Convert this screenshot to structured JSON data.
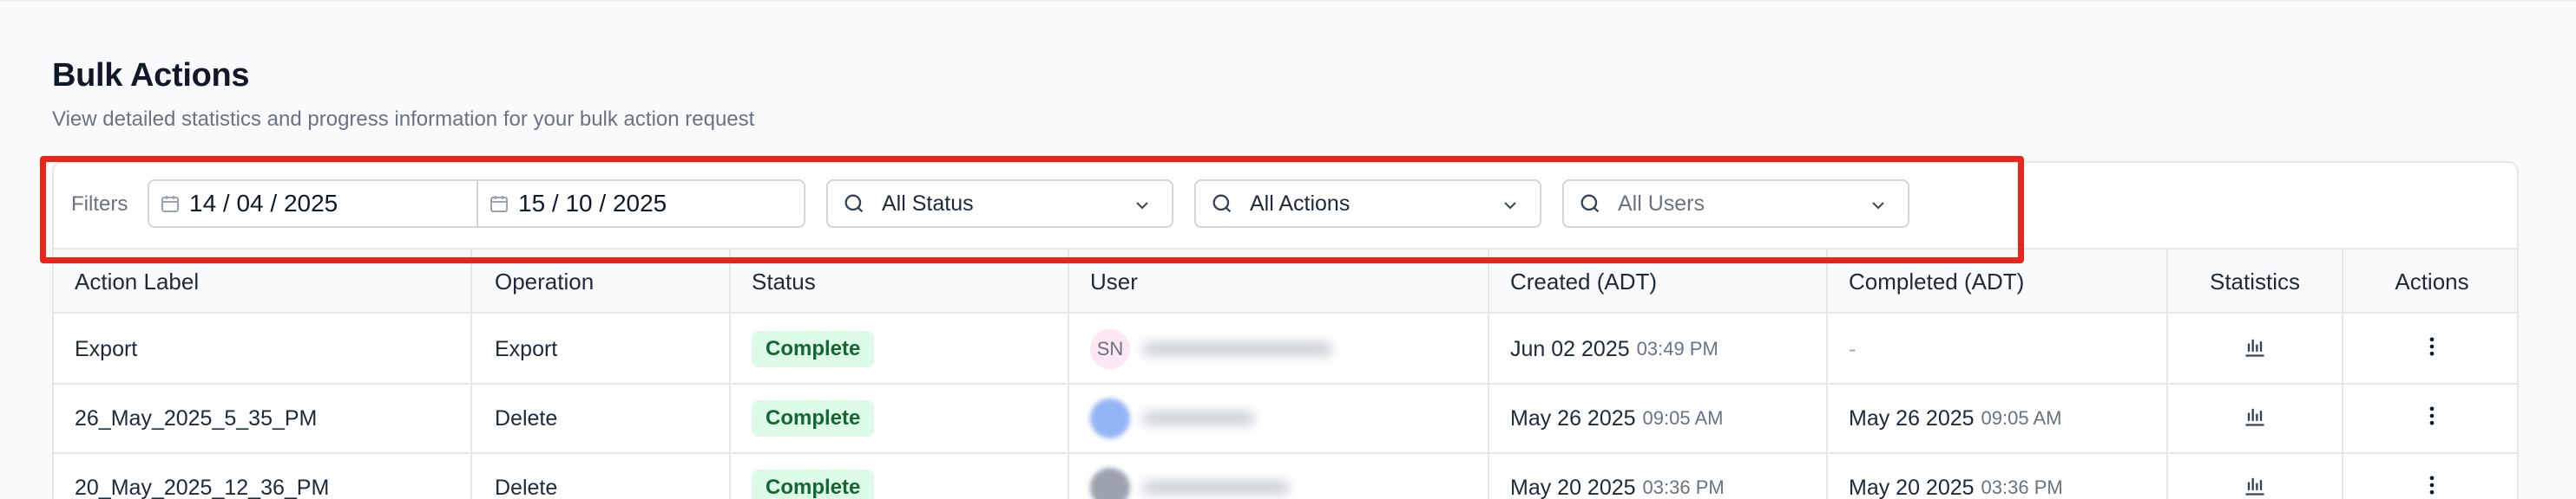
{
  "page": {
    "title": "Bulk Actions",
    "subtitle": "View detailed statistics and progress information for your bulk action request"
  },
  "filters": {
    "label": "Filters",
    "date_from": "14 / 04 / 2025",
    "date_to": "15 / 10 / 2025",
    "status_select": "All Status",
    "actions_select": "All Actions",
    "users_select": "All Users"
  },
  "table": {
    "columns": [
      "Action Label",
      "Operation",
      "Status",
      "User",
      "Created (ADT)",
      "Completed (ADT)",
      "Statistics",
      "Actions"
    ],
    "rows": [
      {
        "action_label": "Export",
        "operation": "Export",
        "status": "Complete",
        "user_initials": "SN",
        "created_date": "Jun 02 2025",
        "created_time": "03:49 PM",
        "completed": "-"
      },
      {
        "action_label": "26_May_2025_5_35_PM",
        "operation": "Delete",
        "status": "Complete",
        "created_date": "May 26 2025",
        "created_time": "09:05 AM",
        "completed_date": "May 26 2025",
        "completed_time": "09:05 AM"
      },
      {
        "action_label": "20_May_2025_12_36_PM",
        "operation": "Delete",
        "status": "Complete",
        "created_date": "May 20 2025",
        "created_time": "03:36 PM",
        "completed_date": "May 20 2025",
        "completed_time": "03:36 PM"
      }
    ]
  },
  "colors": {
    "highlight": "#e8261b",
    "badge_bg": "#dcfce7",
    "badge_text": "#166534"
  },
  "icons": [
    "calendar-icon",
    "search-icon",
    "chevron-down-icon",
    "bar-chart-icon",
    "kebab-menu-icon"
  ]
}
